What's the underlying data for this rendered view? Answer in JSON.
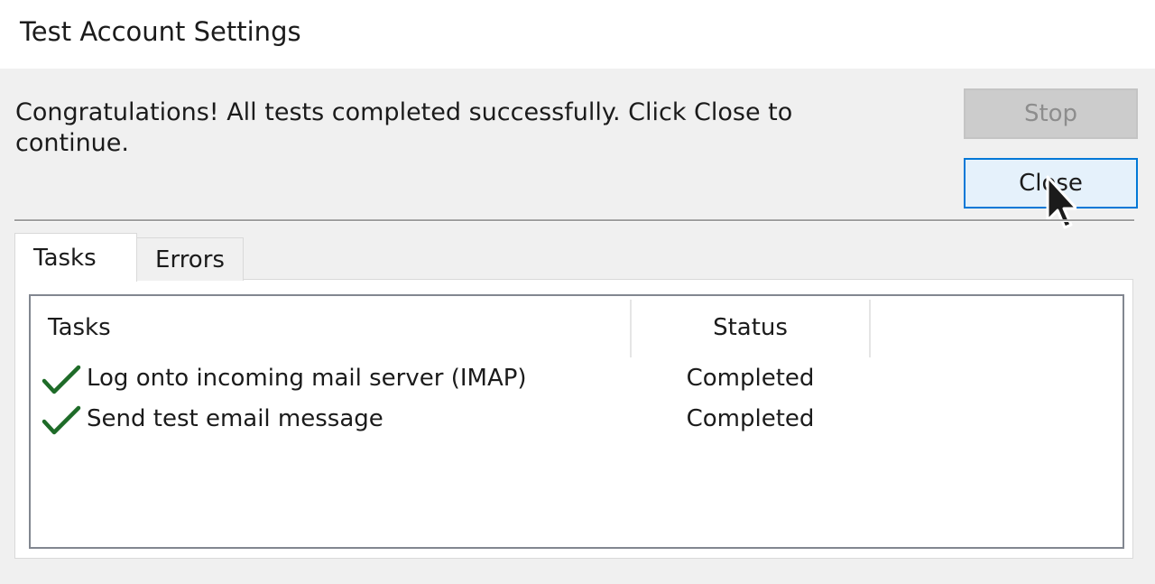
{
  "window": {
    "title": "Test Account Settings"
  },
  "message": "Congratulations! All tests completed successfully. Click Close to continue.",
  "buttons": {
    "stop_label": "Stop",
    "close_label": "Close"
  },
  "tabs": [
    {
      "label": "Tasks",
      "selected": true
    },
    {
      "label": "Errors",
      "selected": false
    }
  ],
  "table": {
    "columns": [
      "Tasks",
      "Status"
    ],
    "rows": [
      {
        "icon": "checkmark-icon",
        "task": "Log onto incoming mail server (IMAP)",
        "status": "Completed"
      },
      {
        "icon": "checkmark-icon",
        "task": "Send test email message",
        "status": "Completed"
      }
    ]
  },
  "colors": {
    "accent": "#0078d7",
    "check": "#1e6b28",
    "dialog_background": "#f0f0f0"
  }
}
